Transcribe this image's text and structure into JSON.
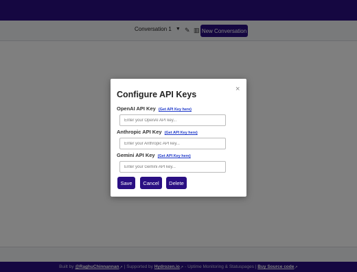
{
  "toolbar": {
    "conversation_select": "Conversation 1",
    "new_conversation_label": "New Conversation",
    "icons": [
      "caret-down-icon",
      "edit-icon",
      "trash-icon"
    ]
  },
  "modal": {
    "title": "Configure API Keys",
    "close_glyph": "×",
    "openai": {
      "label": "OpenAI API Key",
      "link": "(Get API Key here)",
      "placeholder": "Enter your OpenAI API key..."
    },
    "anthropic": {
      "label": "Anthropic API Key",
      "link": "(Get API Key here)",
      "placeholder": "Enter your Anthropic API key..."
    },
    "gemini": {
      "label": "Gemini API Key",
      "link": "(Get API Key here)",
      "placeholder": "Enter your Gemini API key..."
    },
    "buttons": {
      "save": "Save",
      "cancel": "Cancel",
      "delete": "Delete"
    }
  },
  "footer": {
    "built_by": "Built by",
    "author": "@RaghuChinnannan",
    "supported_by": "| Supported by",
    "sponsor": "Hydrozen.io",
    "sponsor_desc": "- Uptime Monitoring & Statuspages |",
    "buy_source": "Buy Source code",
    "external_glyph": "↗"
  },
  "colors": {
    "brand": "#2a0f83",
    "link": "#1a35c8"
  }
}
